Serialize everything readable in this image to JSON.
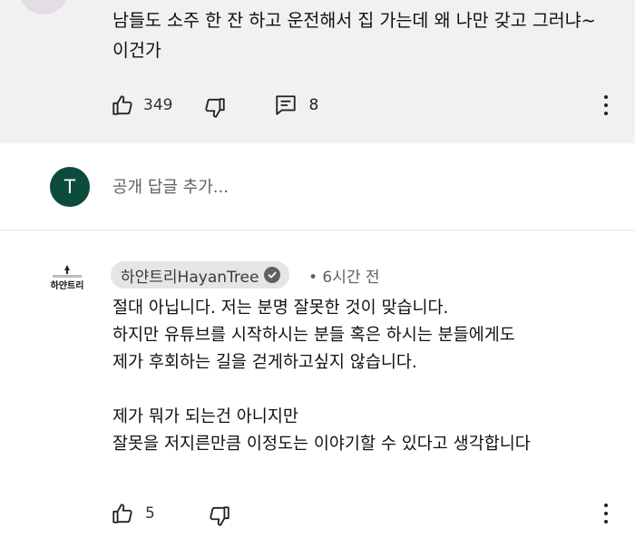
{
  "top_comment": {
    "text": "남들도 소주 한 잔 하고 운전해서 집 가는데 왜 나만 갖고 그러냐~ 이건가",
    "likes": "349",
    "replies": "8"
  },
  "reply_box": {
    "avatar_letter": "T",
    "placeholder": "공개 답글 추가..."
  },
  "creator_reply": {
    "author": "하얀트리HayanTree",
    "time": "• 6시간 전",
    "text": "절대 아닙니다. 저는 분명 잘못한 것이 맞습니다.\n하지만 유튜브를 시작하시는 분들 혹은 하시는 분들에게도\n제가 후회하는 길을 걷게하고싶지 않습니다.\n\n제가 뭐가 되는건 아니지만\n잘못을 저지른만큼 이정도는 이야기할 수 있다고 생각합니다",
    "likes": "5",
    "logo_text": "하얀트리"
  },
  "icons": [
    "thumbs-up-icon",
    "thumbs-down-icon",
    "reply-comment-icon",
    "more-vert-icon",
    "verified-check-icon"
  ],
  "colors": {
    "highlight_bg": "#f1f1f1",
    "avatar_green": "#0d4c3d",
    "chip_bg": "#e5e5e5",
    "secondary_text": "#606060"
  }
}
